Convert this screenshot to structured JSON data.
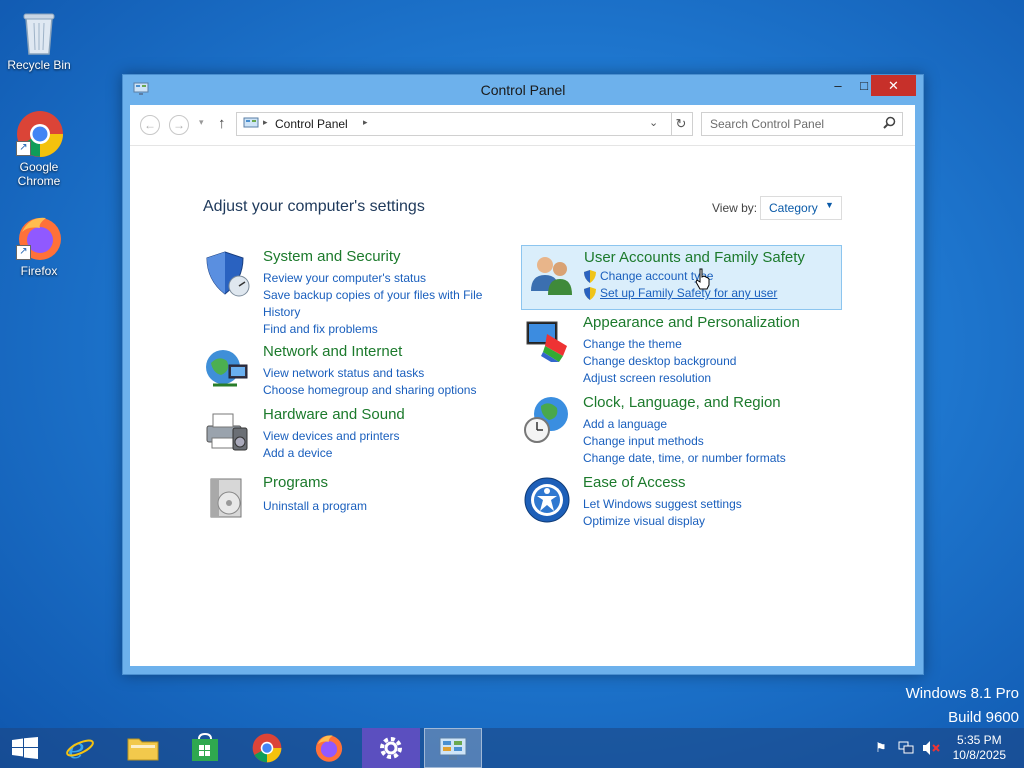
{
  "desktop": {
    "icons": [
      {
        "label": "Recycle Bin"
      },
      {
        "label": "Google Chrome"
      },
      {
        "label": "Firefox"
      }
    ],
    "watermark": {
      "line1": "Windows 8.1 Pro",
      "line2": "Build 9600"
    }
  },
  "window": {
    "title": "Control Panel",
    "controls": {
      "minimize": "–",
      "maximize": "□",
      "close": "✕"
    },
    "address": {
      "crumb": "Control Panel"
    },
    "search": {
      "placeholder": "Search Control Panel"
    },
    "heading": "Adjust your computer's settings",
    "view_by": {
      "label": "View by:",
      "value": "Category"
    }
  },
  "categories": [
    {
      "title": "System and Security",
      "icon": "shield-icon",
      "links": [
        "Review your computer's status",
        "Save backup copies of your files with File",
        "History",
        "Find and fix problems"
      ]
    },
    {
      "title": "Network and Internet",
      "icon": "network-globe-icon",
      "links": [
        "View network status and tasks",
        "Choose homegroup and sharing options"
      ]
    },
    {
      "title": "Hardware and Sound",
      "icon": "printer-icon",
      "links": [
        "View devices and printers",
        "Add a device"
      ]
    },
    {
      "title": "Programs",
      "icon": "programs-icon",
      "links": [
        "Uninstall a program"
      ]
    },
    {
      "title": "User Accounts and Family Safety",
      "icon": "users-icon",
      "links": [
        "Change account type",
        "Set up Family Safety for any user"
      ]
    },
    {
      "title": "Appearance and Personalization",
      "icon": "monitor-icon",
      "links": [
        "Change the theme",
        "Change desktop background",
        "Adjust screen resolution"
      ]
    },
    {
      "title": "Clock, Language, and Region",
      "icon": "clock-globe-icon",
      "links": [
        "Add a language",
        "Change input methods",
        "Change date, time, or number formats"
      ]
    },
    {
      "title": "Ease of Access",
      "icon": "ease-of-access-icon",
      "links": [
        "Let Windows suggest settings",
        "Optimize visual display"
      ]
    }
  ],
  "taskbar": {
    "apps": [
      "start-icon",
      "internet-explorer-icon",
      "file-explorer-icon",
      "store-icon",
      "chrome-icon",
      "firefox-icon",
      "settings-icon",
      "control-panel-icon"
    ],
    "time": "5:35 PM",
    "date": "10/8/2025"
  },
  "colors": {
    "accent": "#1a5fbd",
    "category_title": "#1c7a2c",
    "close": "#c7302a"
  }
}
